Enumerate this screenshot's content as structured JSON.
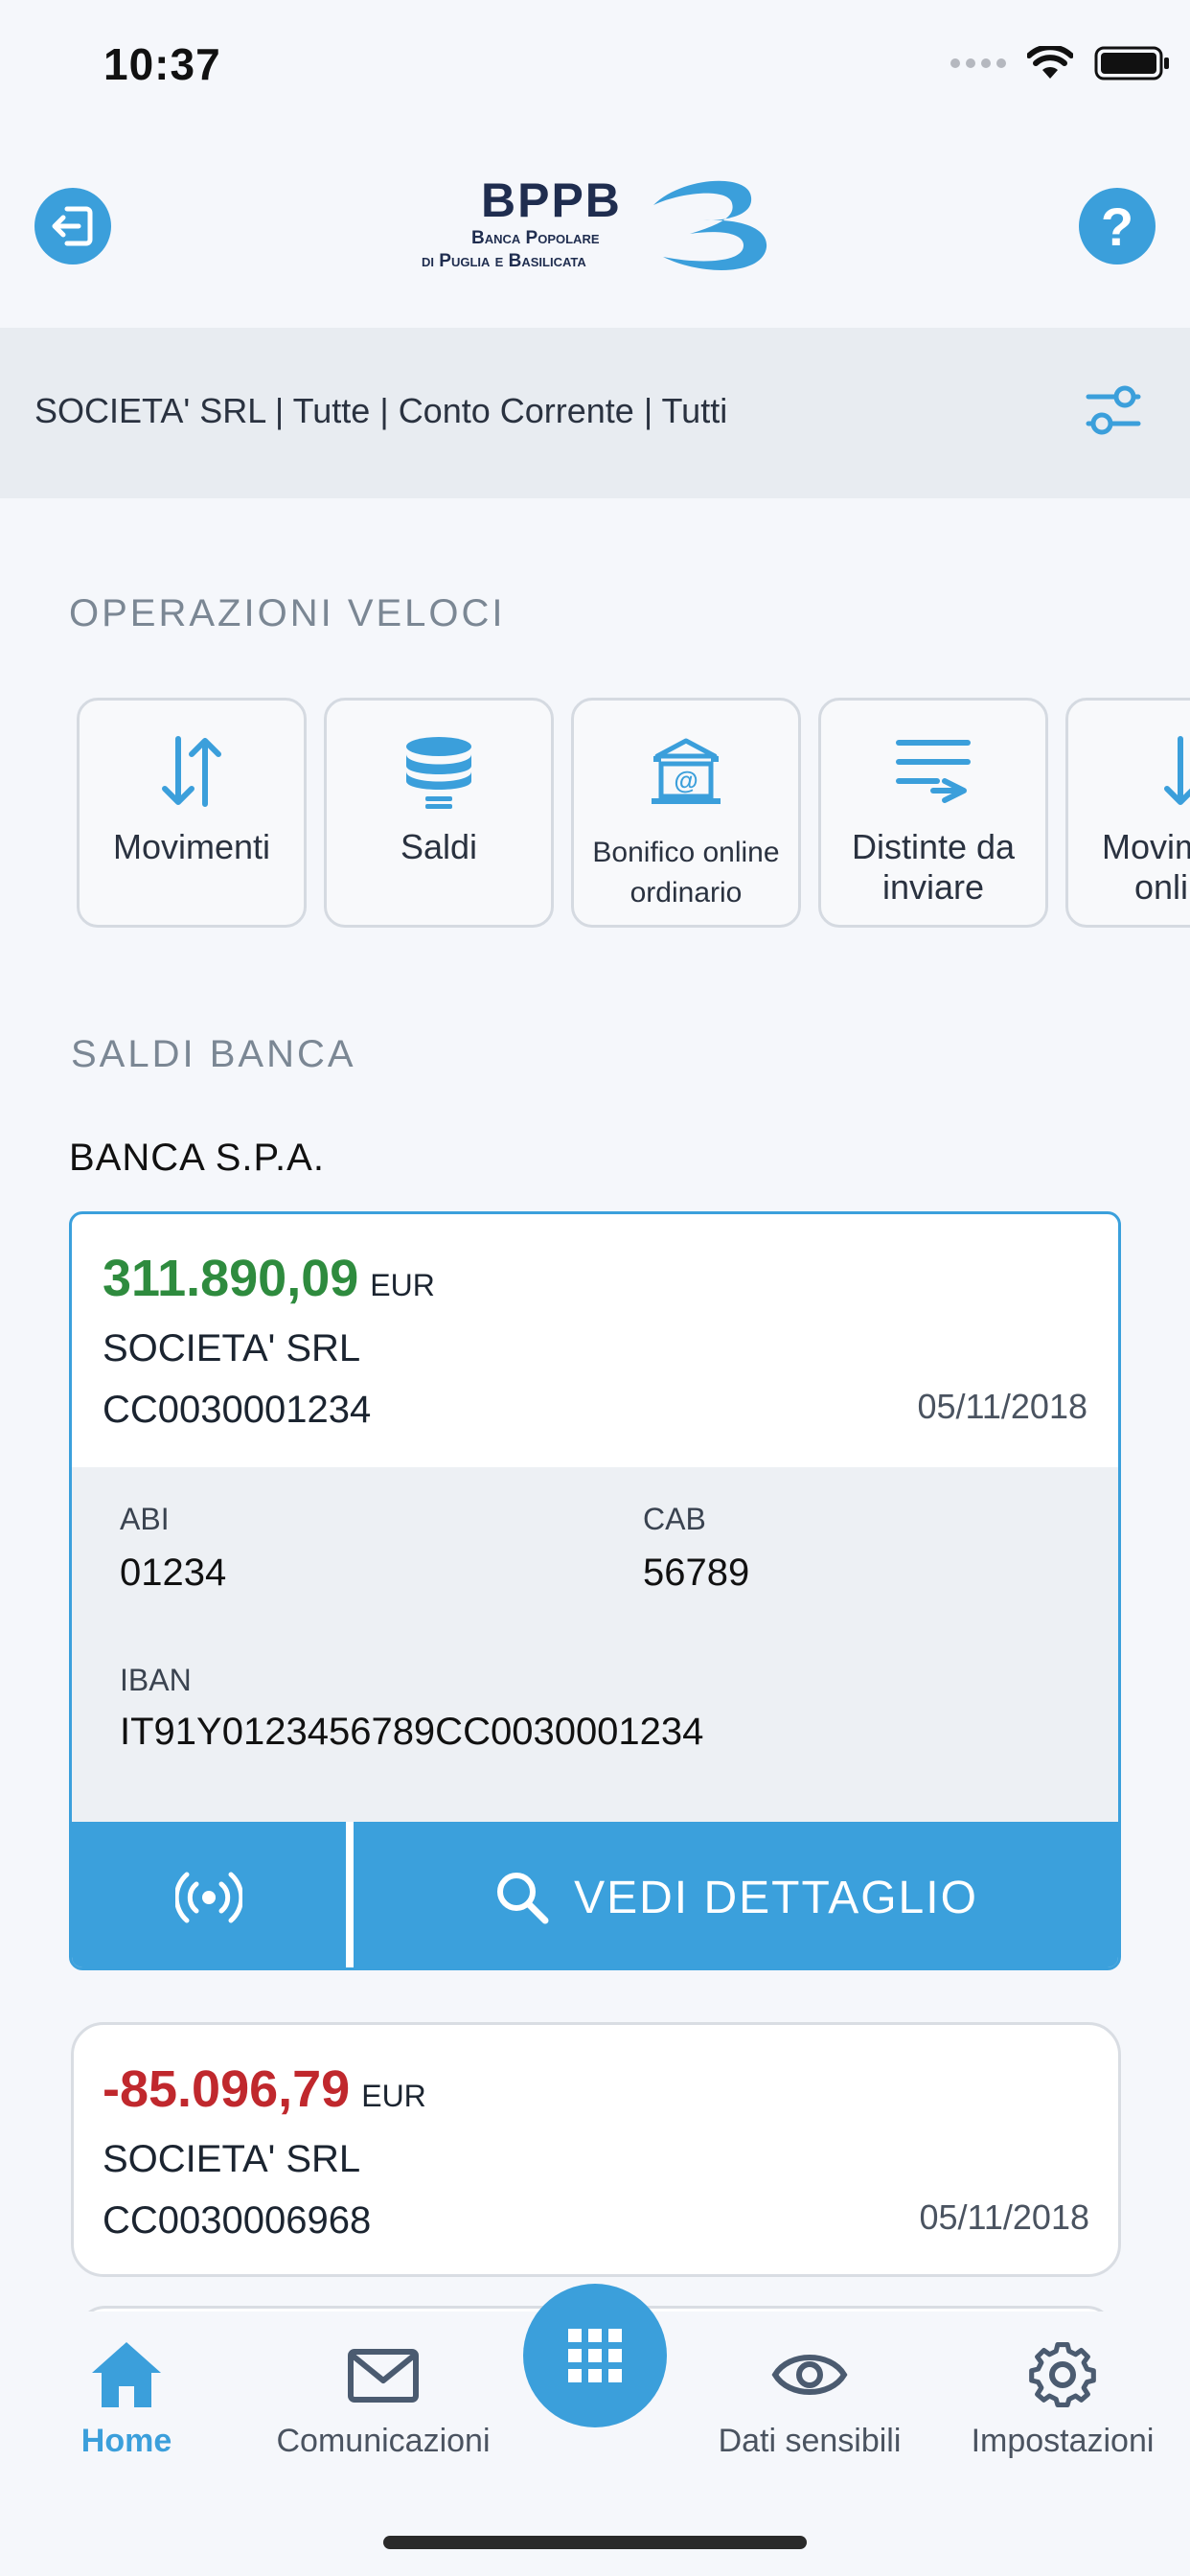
{
  "status_bar": {
    "time": "10:37"
  },
  "header": {
    "logo": {
      "brand": "BPPB",
      "line1": "Banca Popolare",
      "line2": "di Puglia e Basilicata"
    }
  },
  "filter": {
    "text": "SOCIETA' SRL | Tutte | Conto Corrente | Tutti"
  },
  "quick_ops": {
    "title": "OPERAZIONI VELOCI",
    "items": [
      {
        "label": "Movimenti",
        "icon": "arrows-up-down-icon"
      },
      {
        "label": "Saldi",
        "icon": "database-icon"
      },
      {
        "label": "Bonifico online ordinario",
        "icon": "bank-at-icon"
      },
      {
        "label": "Distinte da inviare",
        "icon": "list-send-icon"
      },
      {
        "label": "Movimenti online",
        "icon": "arrow-down-icon"
      }
    ]
  },
  "balances": {
    "title": "SALDI BANCA",
    "bank": "BANCA S.P.A.",
    "accounts": [
      {
        "amount": "311.890,09",
        "currency": "EUR",
        "amount_color": "#2e8b3e",
        "holder": "SOCIETA' SRL",
        "number": "CC0030001234",
        "date": "05/11/2018",
        "abi_label": "ABI",
        "abi": "01234",
        "cab_label": "CAB",
        "cab": "56789",
        "iban_label": "IBAN",
        "iban": "IT91Y0123456789CC0030001234",
        "detail_button": "VEDI DETTAGLIO"
      },
      {
        "amount": "-85.096,79",
        "currency": "EUR",
        "amount_color": "#c0282d",
        "holder": "SOCIETA' SRL",
        "number": "CC0030006968",
        "date": "05/11/2018"
      }
    ]
  },
  "tab_bar": {
    "items": [
      {
        "label": "Home",
        "icon": "home-icon",
        "active": true
      },
      {
        "label": "Comunicazioni",
        "icon": "mail-icon"
      },
      {
        "label": "Dati sensibili",
        "icon": "eye-icon"
      },
      {
        "label": "Impostazioni",
        "icon": "gear-icon"
      }
    ],
    "fab_icon": "grid-icon"
  },
  "colors": {
    "accent": "#3b9fdb",
    "positive": "#2e8b3e",
    "negative": "#c0282d"
  }
}
